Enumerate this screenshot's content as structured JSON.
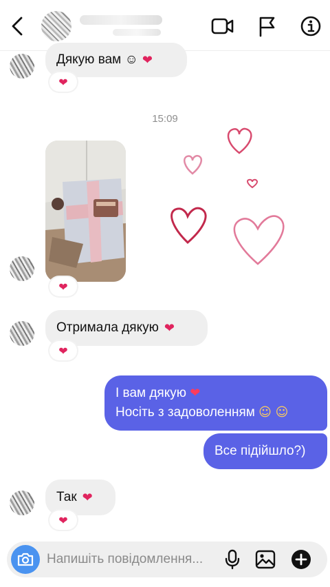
{
  "header": {
    "back_icon": "chevron-left-icon",
    "video_icon": "video-call-icon",
    "flag_icon": "flag-icon",
    "info_icon": "info-icon"
  },
  "messages": [
    {
      "type": "incoming",
      "text": "Дякую вам ☺",
      "heart": "❤",
      "reaction": "❤"
    },
    {
      "type": "timestamp",
      "text": "15:09"
    },
    {
      "type": "incoming-photo",
      "reaction": "❤"
    },
    {
      "type": "incoming",
      "text": "Отримала дякую",
      "heart": "❤",
      "reaction": "❤"
    },
    {
      "type": "outgoing",
      "line1": "І вам дякую",
      "heart": "❤",
      "line2": "Носіть з задоволенням",
      "line2_emoji": "☺ ☺"
    },
    {
      "type": "outgoing",
      "text": "Все підійшло?)"
    },
    {
      "type": "incoming",
      "text": "Так",
      "heart": "❤",
      "reaction": "❤"
    }
  ],
  "composer": {
    "placeholder": "Напишіть повідомлення...",
    "camera_icon": "camera-icon",
    "mic_icon": "microphone-icon",
    "gallery_icon": "image-icon",
    "add_icon": "plus-circle-icon"
  },
  "colors": {
    "outgoing_bubble": "#5a62e6",
    "incoming_bubble": "#efefef",
    "heart": "#e0245e",
    "camera_button": "#4a93f0"
  }
}
